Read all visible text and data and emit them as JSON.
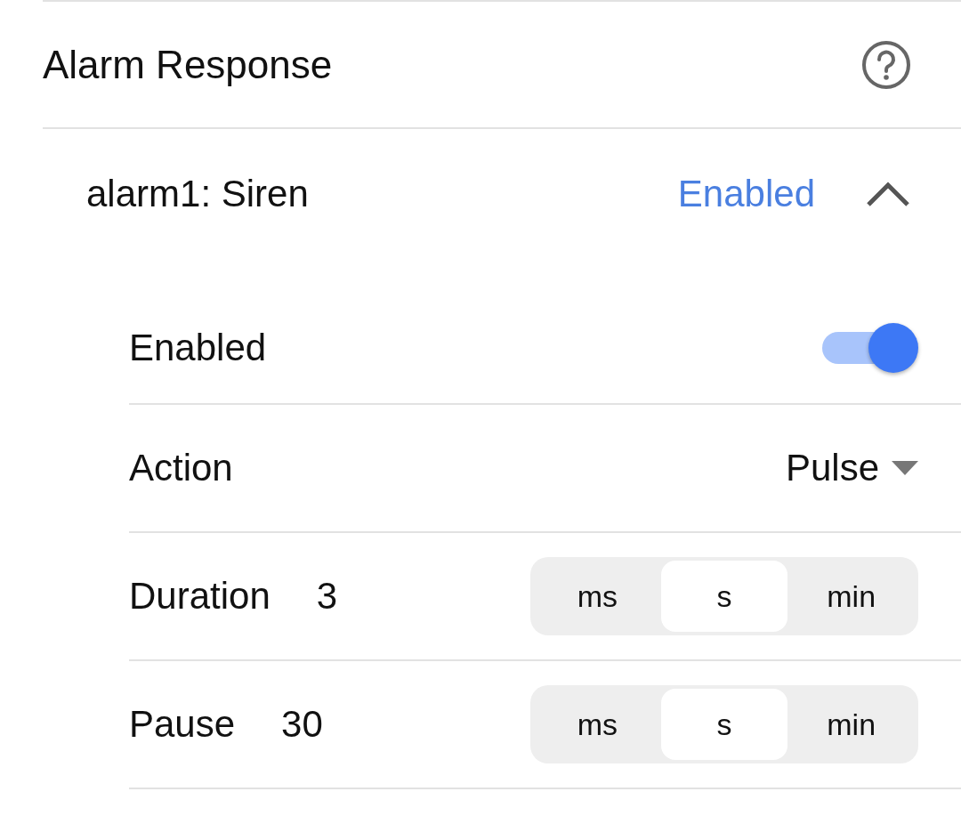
{
  "header": {
    "title": "Alarm Response"
  },
  "alarm": {
    "name": "alarm1: Siren",
    "status": "Enabled",
    "expanded": true,
    "settings": [
      {
        "kind": "toggle",
        "label": "Enabled",
        "on": true
      },
      {
        "kind": "dropdown",
        "label": "Action",
        "value": "Pulse"
      },
      {
        "kind": "time",
        "label": "Duration",
        "value": "3",
        "units": [
          {
            "label": "ms",
            "selected": false
          },
          {
            "label": "s",
            "selected": true
          },
          {
            "label": "min",
            "selected": false
          }
        ]
      },
      {
        "kind": "time",
        "label": "Pause",
        "value": "30",
        "units": [
          {
            "label": "ms",
            "selected": false
          },
          {
            "label": "s",
            "selected": true
          },
          {
            "label": "min",
            "selected": false
          }
        ]
      }
    ]
  }
}
